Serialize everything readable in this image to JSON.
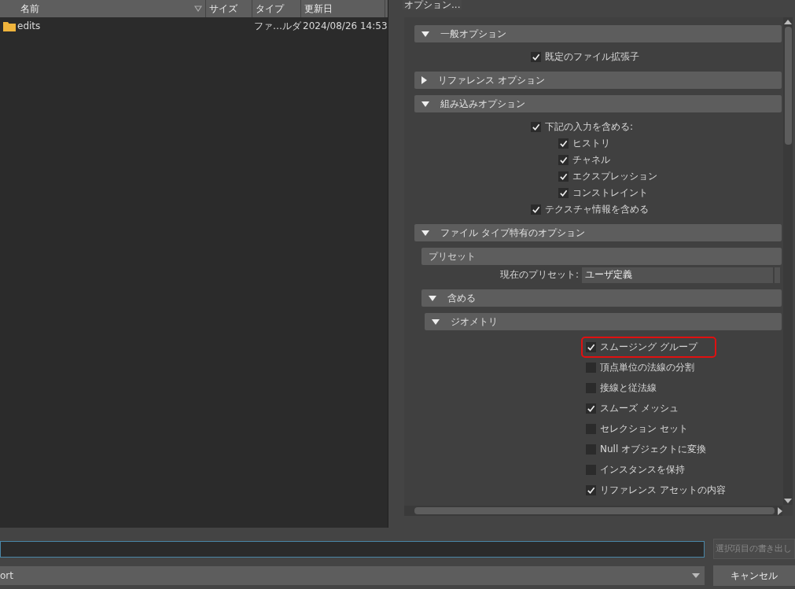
{
  "file_list": {
    "columns": [
      {
        "label": "名前",
        "sorted": true
      },
      {
        "label": "サイズ",
        "sorted": false
      },
      {
        "label": "タイプ",
        "sorted": false
      },
      {
        "label": "更新日",
        "sorted": false
      }
    ],
    "rows": [
      {
        "name": "edits",
        "type": "ファ…ルダ",
        "modified": "2024/08/26 14:53"
      }
    ]
  },
  "options": {
    "title": "オプション...",
    "sections": [
      {
        "kind": "section",
        "title": "一般オプション",
        "expanded": true,
        "items": [
          {
            "kind": "checkbox",
            "label": "既定のファイル拡張子",
            "checked": true
          }
        ]
      },
      {
        "kind": "section",
        "title": "リファレンス オプション",
        "expanded": false
      },
      {
        "kind": "section",
        "title": "組み込みオプション",
        "expanded": true,
        "items": [
          {
            "kind": "checkbox",
            "label": "下記の入力を含める:",
            "checked": true,
            "children": [
              {
                "kind": "checkbox",
                "label": "ヒストリ",
                "checked": true
              },
              {
                "kind": "checkbox",
                "label": "チャネル",
                "checked": true
              },
              {
                "kind": "checkbox",
                "label": "エクスプレッション",
                "checked": true
              },
              {
                "kind": "checkbox",
                "label": "コンストレイント",
                "checked": true
              }
            ]
          },
          {
            "kind": "checkbox",
            "label": "テクスチャ情報を含める",
            "checked": true
          }
        ]
      },
      {
        "kind": "section",
        "title": "ファイル タイプ特有のオプション",
        "expanded": true,
        "items": [
          {
            "kind": "group",
            "title": "プリセット",
            "items": [
              {
                "kind": "field",
                "label": "現在のプリセット:",
                "value": "ユーザ定義"
              }
            ]
          },
          {
            "kind": "section",
            "title": "含める",
            "expanded": true,
            "items": [
              {
                "kind": "section",
                "title": "ジオメトリ",
                "expanded": true,
                "items": [
                  {
                    "kind": "checkbox",
                    "label": "スムージング グループ",
                    "checked": true,
                    "highlighted": true
                  },
                  {
                    "kind": "checkbox",
                    "label": "頂点単位の法線の分割",
                    "checked": false,
                    "highlighted": false
                  },
                  {
                    "kind": "checkbox",
                    "label": "接線と従法線",
                    "checked": false,
                    "highlighted": false
                  },
                  {
                    "kind": "checkbox",
                    "label": "スムーズ メッシュ",
                    "checked": true,
                    "highlighted": false
                  },
                  {
                    "kind": "checkbox",
                    "label": "セレクション セット",
                    "checked": false,
                    "highlighted": false
                  },
                  {
                    "kind": "checkbox",
                    "label": "Null オブジェクトに変換",
                    "checked": false,
                    "highlighted": false
                  },
                  {
                    "kind": "checkbox",
                    "label": "インスタンスを保持",
                    "checked": false,
                    "highlighted": false
                  },
                  {
                    "kind": "checkbox",
                    "label": "リファレンス アセットの内容",
                    "checked": true,
                    "highlighted": false
                  }
                ]
              }
            ]
          }
        ]
      }
    ]
  },
  "bottom": {
    "export_button": "選択項目の書き出し",
    "file_type": "ort",
    "cancel_button": "キャンセル"
  }
}
